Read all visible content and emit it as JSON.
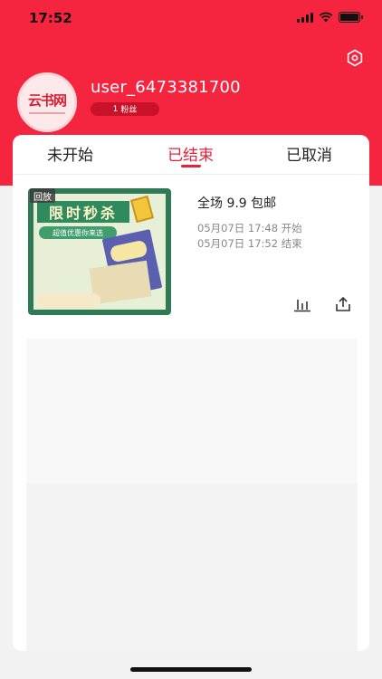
{
  "status_bar": {
    "time": "17:52"
  },
  "profile": {
    "avatar_logo_text": "云书网",
    "username": "user_6473381700",
    "fans_count": "1",
    "fans_label": "粉丝"
  },
  "tabs": [
    {
      "label": "未开始",
      "active": false
    },
    {
      "label": "已结束",
      "active": true
    },
    {
      "label": "已取消",
      "active": false
    }
  ],
  "events": [
    {
      "tag": "回放",
      "thumbnail": {
        "banner": "限时秒杀",
        "subtitle": "超值优惠你来选"
      },
      "title": "全场 9.9 包邮",
      "start_time": "05月07日 17:48 开始",
      "end_time": "05月07日 17:52 结束"
    }
  ],
  "colors": {
    "brand_red": "#f5243f",
    "accent_red": "#e5223a"
  },
  "icons": [
    "settings-icon",
    "stats-icon",
    "share-icon"
  ]
}
